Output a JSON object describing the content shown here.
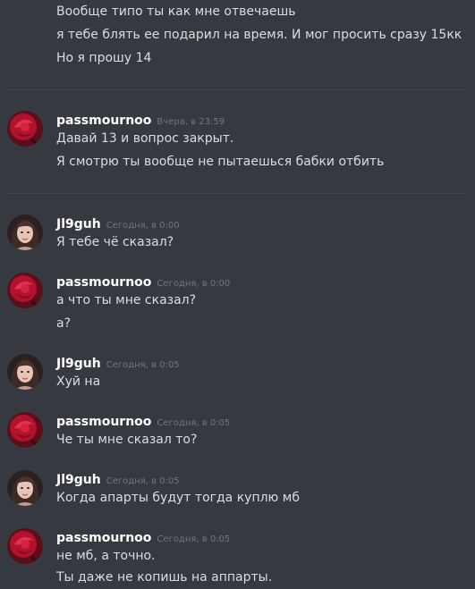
{
  "colors": {
    "background": "#36393f",
    "text": "#dcddde",
    "username": "#ffffff",
    "timestamp": "#72767d",
    "divider": "#42454a"
  },
  "top_lines": [
    "Вообще типо ты как мне отвечаешь",
    "я тебе блять ее подарил на время. И мог просить сразу 15кк",
    "Но я прошу 14"
  ],
  "messages": [
    {
      "author": "passmournoo",
      "avatar_icon": "red-rose-avatar-icon",
      "timestamp": "Вчера, в 23:59",
      "lines": [
        "Давай 13 и вопрос закрыт.",
        "Я смотрю ты вообще не пытаешься бабки отбить"
      ]
    },
    {
      "author": "Jl9guh",
      "avatar_icon": "girl-portrait-avatar-icon",
      "timestamp": "Сегодня, в 0:00",
      "lines": [
        "Я тебе чё сказал?"
      ]
    },
    {
      "author": "passmournoo",
      "avatar_icon": "red-rose-avatar-icon",
      "timestamp": "Сегодня, в 0:00",
      "lines": [
        "а что ты мне сказал?",
        "а?"
      ]
    },
    {
      "author": "Jl9guh",
      "avatar_icon": "girl-portrait-avatar-icon",
      "timestamp": "Сегодня, в 0:05",
      "lines": [
        "Хуй на"
      ]
    },
    {
      "author": "passmournoo",
      "avatar_icon": "red-rose-avatar-icon",
      "timestamp": "Сегодня, в 0:05",
      "lines": [
        "Че ты мне сказал то?"
      ]
    },
    {
      "author": "Jl9guh",
      "avatar_icon": "girl-portrait-avatar-icon",
      "timestamp": "Сегодня, в 0:05",
      "lines": [
        "Когда апарты будут тогда куплю мб"
      ]
    },
    {
      "author": "passmournoo",
      "avatar_icon": "red-rose-avatar-icon",
      "timestamp": "Сегодня, в 0:05",
      "lines": [
        "не мб, а точно.",
        "Ты даже не копишь на аппарты."
      ]
    }
  ]
}
